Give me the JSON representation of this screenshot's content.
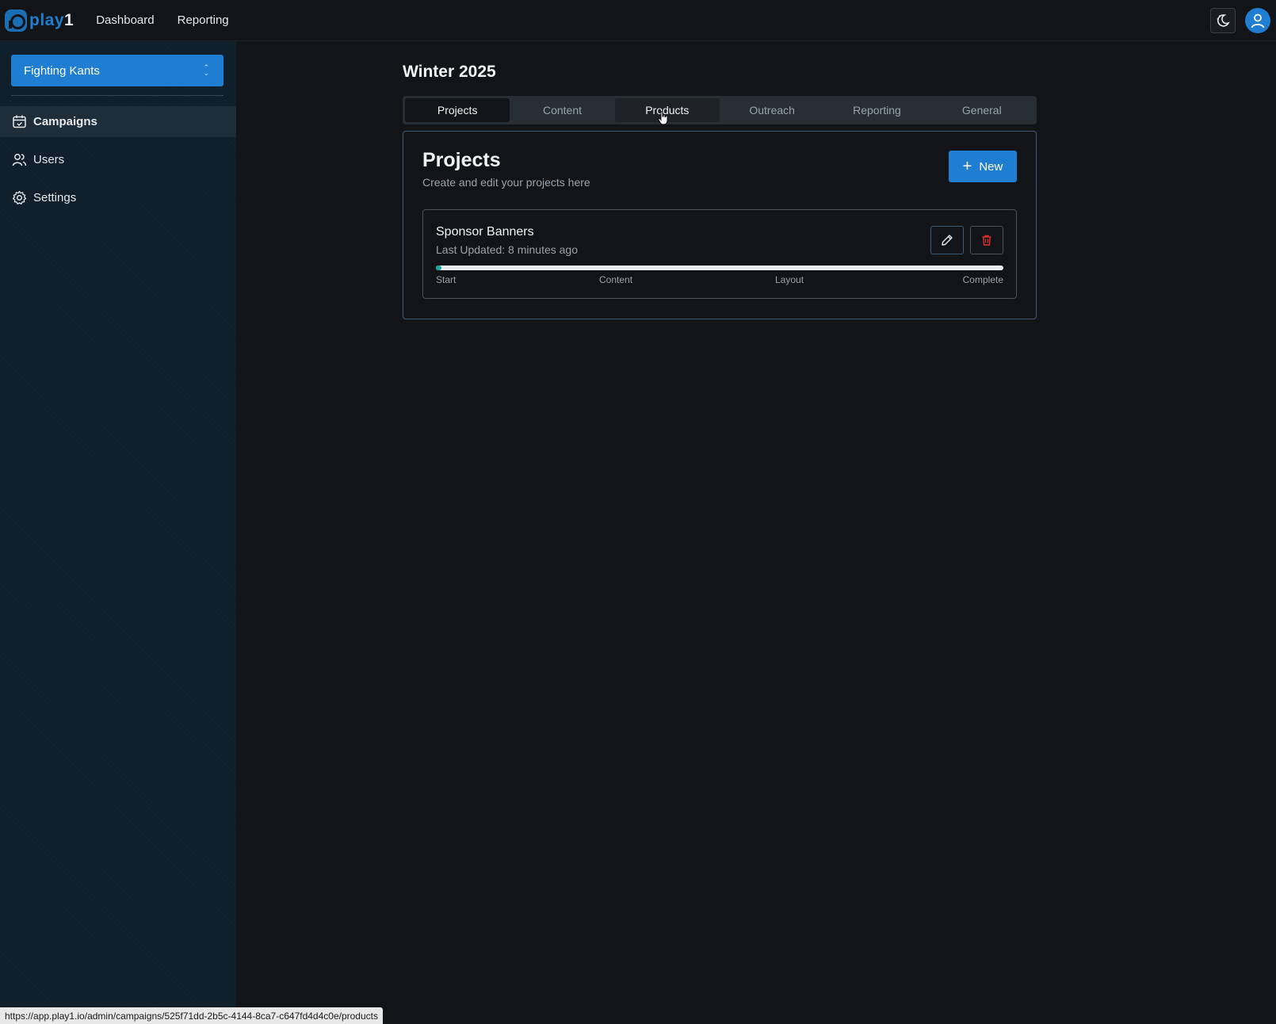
{
  "header": {
    "logo_text": "play",
    "logo_number": "1",
    "nav": [
      "Dashboard",
      "Reporting"
    ]
  },
  "sidebar": {
    "organization": "Fighting Kants",
    "items": [
      {
        "label": "Campaigns",
        "icon": "calendar-icon",
        "active": true
      },
      {
        "label": "Users",
        "icon": "users-icon",
        "active": false
      },
      {
        "label": "Settings",
        "icon": "gear-icon",
        "active": false
      }
    ]
  },
  "main": {
    "title": "Winter 2025",
    "tabs": [
      {
        "label": "Projects",
        "state": "active"
      },
      {
        "label": "Content",
        "state": "normal"
      },
      {
        "label": "Products",
        "state": "hover"
      },
      {
        "label": "Outreach",
        "state": "normal"
      },
      {
        "label": "Reporting",
        "state": "normal"
      },
      {
        "label": "General",
        "state": "normal"
      }
    ],
    "card": {
      "title": "Projects",
      "subtitle": "Create and edit your projects here",
      "new_button": "New",
      "projects": [
        {
          "name": "Sponsor Banners",
          "updated": "Last Updated: 8 minutes ago",
          "progress": 0.01,
          "steps": [
            "Start",
            "Content",
            "Layout",
            "Complete"
          ]
        }
      ]
    }
  },
  "status_bar": {
    "url": "https://app.play1.io/admin/campaigns/525f71dd-2b5c-4144-8ca7-c647fd4d4c0e/products"
  },
  "colors": {
    "accent": "#1f7ed1",
    "progress": "#1aa4a4",
    "delete": "#e03131"
  }
}
